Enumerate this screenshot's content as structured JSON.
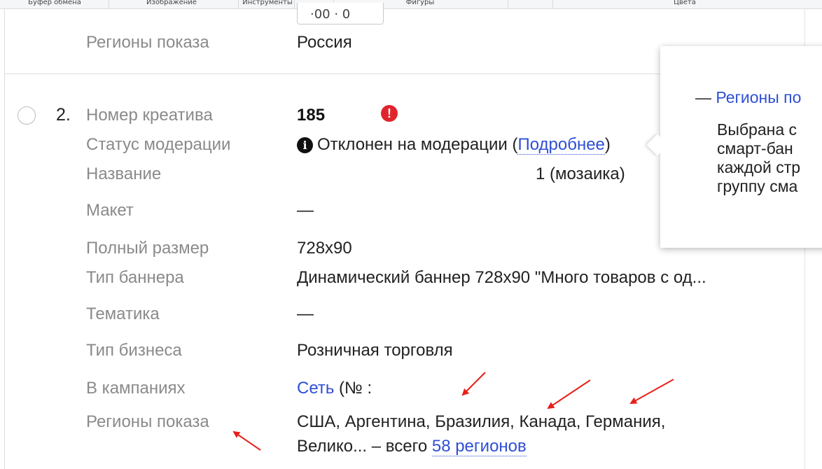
{
  "ribbon": {
    "clipboard": "Буфер обмена",
    "image": "Изображение",
    "tools": "Инструменты",
    "shapes": "Фигуры",
    "colors": "Цвета"
  },
  "previous_row": {
    "select_value": "·00 · 0",
    "regions_label": "Регионы показа",
    "regions_value": "Россия"
  },
  "creative": {
    "index": "2.",
    "warning_icon": "exclamation-icon",
    "fields": {
      "number_label": "Номер креатива",
      "number_value": "185",
      "moderation_label": "Статус модерации",
      "moderation_icon": "info-icon",
      "moderation_text": "Отклонен на модерации (",
      "moderation_link": "Подробнее",
      "moderation_close": ")",
      "name_label": "Название",
      "name_value": "1 (мозаика)",
      "layout_label": "Макет",
      "layout_value": "—",
      "size_label": "Полный размер",
      "size_value": "728x90",
      "banner_type_label": "Тип баннера",
      "banner_type_value": "Динамический баннер 728x90 \"Много товаров с од...",
      "topic_label": "Тематика",
      "topic_value": "—",
      "business_label": "Тип бизнеса",
      "business_value": "Розничная торговля",
      "campaigns_label": "В кампаниях",
      "campaigns_link": "Сеть",
      "campaigns_rest": " (№ :",
      "regions_label": "Регионы показа",
      "regions_line1": "США, Аргентина, Бразилия, Канада, Германия,",
      "regions_line2_prefix": "Велико... – всего ",
      "regions_link": "58 регионов"
    }
  },
  "popup": {
    "title_dash": "— ",
    "title_link": "Регионы по",
    "lines": [
      "Выбрана с",
      "смарт-бан",
      "каждой стр",
      "группу сма"
    ]
  },
  "colors": {
    "link": "#2f4fd4",
    "label": "#8a8a8a",
    "error": "#e0242d",
    "arrow": "#e8201a"
  }
}
